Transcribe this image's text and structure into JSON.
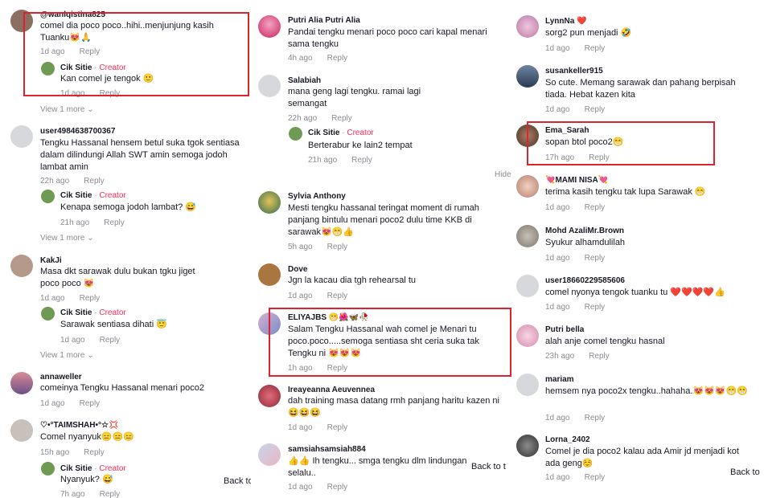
{
  "ui": {
    "view_more": "View 1 more",
    "reply": "Reply",
    "creator_sep": "·",
    "back_to": "Back to",
    "back_to_partial": "Back to t",
    "hide_partial": "Hide"
  },
  "col1": [
    {
      "user": "@wanlqistina825",
      "text": "comel dia poco poco..hihi..menjunjung kasih Tuanku😻🙏",
      "time": "1d ago",
      "reply": {
        "user": "Cik Sitie",
        "tag": "Creator",
        "text": "Kan comel je tengok 🙂",
        "time": "1d ago"
      }
    },
    {
      "user": "user4984638700367",
      "text": "Tengku Hassanal hensem betul suka tgok sentiasa dalam dilindungi Allah SWT amin semoga jodoh lambat amin",
      "time": "22h ago",
      "reply": {
        "user": "Cik Sitie",
        "tag": "Creator",
        "text": "Kenapa semoga jodoh lambat? 😅",
        "time": "21h ago"
      }
    },
    {
      "user": "KakJi",
      "text": "Masa dkt sarawak dulu bukan tgku jiget poco poco 😻",
      "time": "1d ago",
      "reply": {
        "user": "Cik Sitie",
        "tag": "Creator",
        "text": "Sarawak sentiasa dihati 😇",
        "time": "1d ago"
      }
    },
    {
      "user": "annaweller",
      "text": "comeinya Tengku Hassanal menari poco2",
      "time": "1d ago"
    },
    {
      "user": "♡•°TAIMSHAH•°☆💢",
      "text": "Comel nyanyuk😑😑😑",
      "time": "15h ago",
      "reply": {
        "user": "Cik Sitie",
        "tag": "Creator",
        "text": "Nyanyuk? 😅",
        "time": "7h ago"
      }
    }
  ],
  "col2": [
    {
      "user": "Putri Alia Putri Alia",
      "text": "Pandai tengku menari poco poco cari kapal menari sama tengku",
      "time": "4h ago"
    },
    {
      "user": "Salabiah",
      "text": "mana geng lagi tengku. ramai lagi semangat",
      "time": "22h ago",
      "reply": {
        "user": "Cik Sitie",
        "tag": "Creator",
        "text": "Berterabur ke lain2 tempat",
        "time": "21h ago"
      }
    },
    {
      "user": "Sylvia Anthony",
      "text": "Mesti tengku hassanal teringat moment di rumah panjang bintulu menari poco2 dulu time KKB di sarawak😻😁👍",
      "time": "5h ago"
    },
    {
      "user": "Dove",
      "text": "Jgn la kacau dia tgh rehearsal tu",
      "time": "1d ago"
    },
    {
      "user": "ELIYAJBS 😁🌺🦋🥀",
      "text": "Salam Tengku Hassanal wah comel je Menari tu poco.poco.....semoga sentiasa sht ceria suka tak Tengku ni 😻😻😻",
      "time": "1h ago"
    },
    {
      "user": "Ireayeanna Aeuvennea",
      "text": "dah training masa datang rmh panjang haritu kazen ni😆😆😆",
      "time": "1d ago"
    },
    {
      "user": "samsiahsamsiah884",
      "text": "👍👍 Ih tengku... smga tengku dlm lindungan selalu..",
      "time": "1d ago"
    }
  ],
  "col3": [
    {
      "user": "LynnNa ❤️",
      "text": "sorg2 pun menjadi 🤣",
      "time": "1d ago"
    },
    {
      "user": "susankeller915",
      "text": "So cute. Memang sarawak dan pahang berpisah tiada. Hebat kazen kita",
      "time": "1d ago"
    },
    {
      "user": "Ema_Sarah",
      "text": "sopan btol poco2😁",
      "time": "17h ago"
    },
    {
      "user": "💘MAMI NISA💘",
      "text": "terima kasih tengku tak lupa Sarawak 😁",
      "time": "1d ago"
    },
    {
      "user": "Mohd AzaliMr.Brown",
      "text": "Syukur alhamdulilah",
      "time": "1d ago"
    },
    {
      "user": "user18660229585606",
      "text": "comel nyonya tengok tuanku tu ❤️❤️❤️❤️👍",
      "time": "1d ago"
    },
    {
      "user": "Putri bella",
      "text": "alah anje comel tengku hasnal",
      "time": "23h ago"
    },
    {
      "user": "mariam",
      "text": "hemsem nya poco2x tengku..hahaha.😻😻😻😁😁",
      "time": "1d ago"
    },
    {
      "user": "Lorna_2402",
      "text": "Comel je dia poco2 kalau ada Amir jd menjadi kot ada geng☺️",
      "time": "1d ago"
    }
  ],
  "colors": {
    "highlight": "#e0212f",
    "creator": "#fe2c55",
    "meta": "#8a8b91"
  }
}
